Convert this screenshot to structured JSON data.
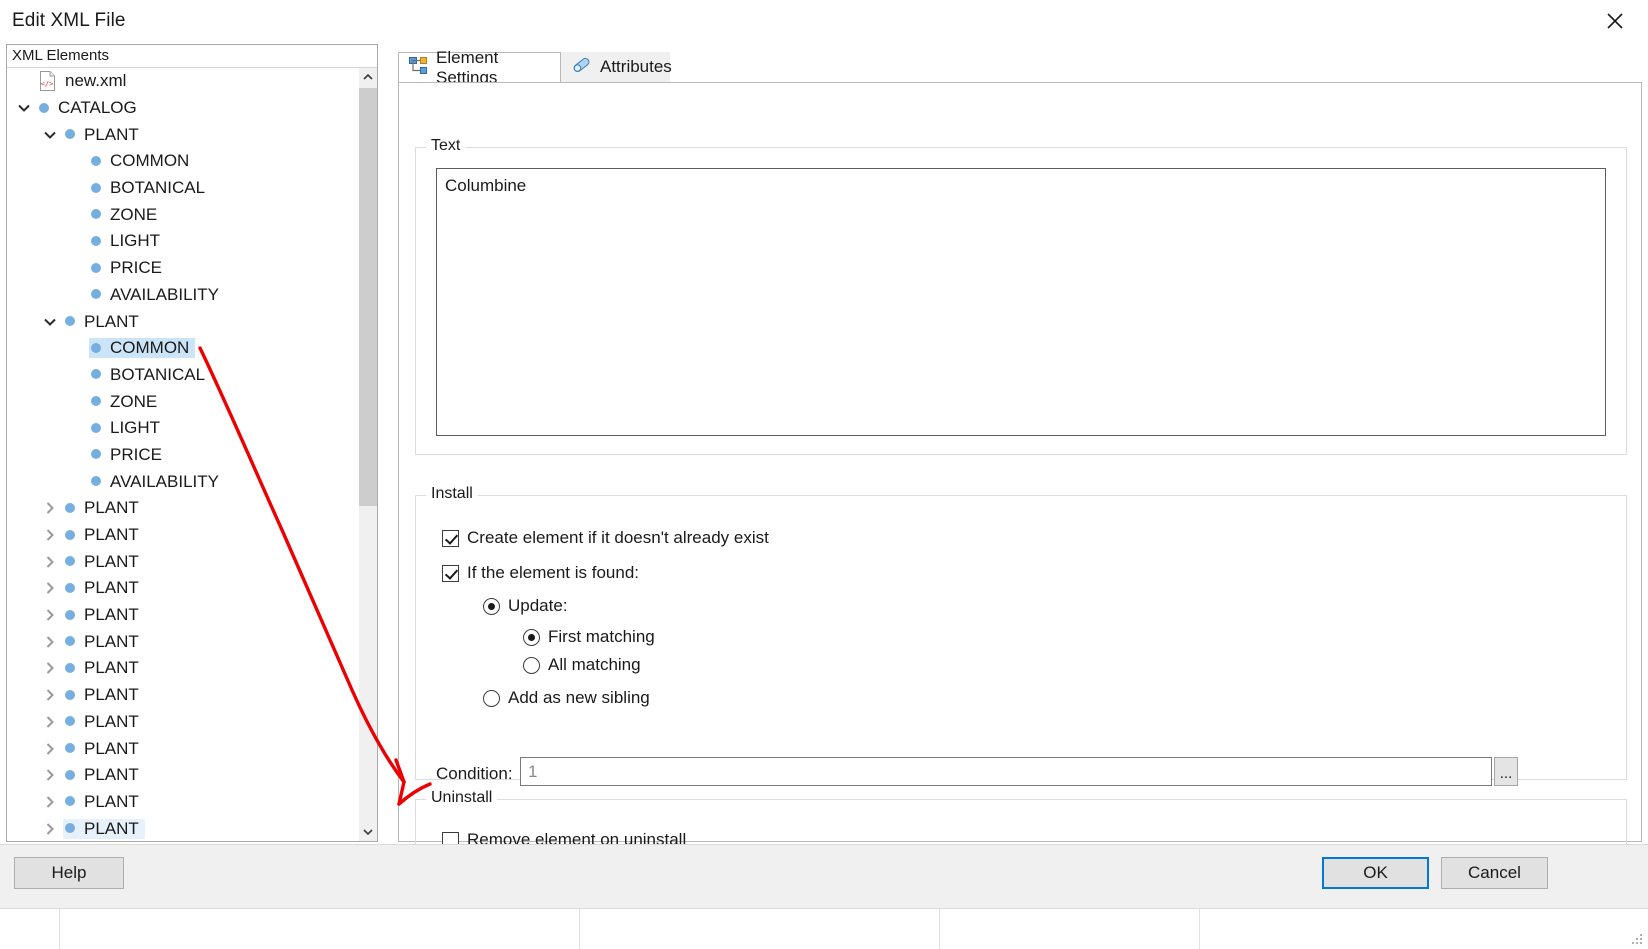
{
  "window": {
    "title": "Edit XML File",
    "close_label": "close-icon"
  },
  "tree": {
    "header": "XML Elements",
    "root": "new.xml",
    "nodes": [
      {
        "label": "new.xml",
        "indent": 0,
        "twisty": "none",
        "icon": "xml-file-icon",
        "state": "normal"
      },
      {
        "label": "CATALOG",
        "indent": 0,
        "twisty": "expanded",
        "icon": "bullet",
        "state": "normal"
      },
      {
        "label": "PLANT",
        "indent": 1,
        "twisty": "expanded",
        "icon": "bullet",
        "state": "normal"
      },
      {
        "label": "COMMON",
        "indent": 2,
        "twisty": "none",
        "icon": "bullet",
        "state": "normal"
      },
      {
        "label": "BOTANICAL",
        "indent": 2,
        "twisty": "none",
        "icon": "bullet",
        "state": "normal"
      },
      {
        "label": "ZONE",
        "indent": 2,
        "twisty": "none",
        "icon": "bullet",
        "state": "normal"
      },
      {
        "label": "LIGHT",
        "indent": 2,
        "twisty": "none",
        "icon": "bullet",
        "state": "normal"
      },
      {
        "label": "PRICE",
        "indent": 2,
        "twisty": "none",
        "icon": "bullet",
        "state": "normal"
      },
      {
        "label": "AVAILABILITY",
        "indent": 2,
        "twisty": "none",
        "icon": "bullet",
        "state": "normal"
      },
      {
        "label": "PLANT",
        "indent": 1,
        "twisty": "expanded",
        "icon": "bullet",
        "state": "normal"
      },
      {
        "label": "COMMON",
        "indent": 2,
        "twisty": "none",
        "icon": "bullet",
        "state": "selected"
      },
      {
        "label": "BOTANICAL",
        "indent": 2,
        "twisty": "none",
        "icon": "bullet",
        "state": "normal"
      },
      {
        "label": "ZONE",
        "indent": 2,
        "twisty": "none",
        "icon": "bullet",
        "state": "normal"
      },
      {
        "label": "LIGHT",
        "indent": 2,
        "twisty": "none",
        "icon": "bullet",
        "state": "normal"
      },
      {
        "label": "PRICE",
        "indent": 2,
        "twisty": "none",
        "icon": "bullet",
        "state": "normal"
      },
      {
        "label": "AVAILABILITY",
        "indent": 2,
        "twisty": "none",
        "icon": "bullet",
        "state": "normal"
      },
      {
        "label": "PLANT",
        "indent": 1,
        "twisty": "collapsed",
        "icon": "bullet",
        "state": "normal"
      },
      {
        "label": "PLANT",
        "indent": 1,
        "twisty": "collapsed",
        "icon": "bullet",
        "state": "normal"
      },
      {
        "label": "PLANT",
        "indent": 1,
        "twisty": "collapsed",
        "icon": "bullet",
        "state": "normal"
      },
      {
        "label": "PLANT",
        "indent": 1,
        "twisty": "collapsed",
        "icon": "bullet",
        "state": "normal"
      },
      {
        "label": "PLANT",
        "indent": 1,
        "twisty": "collapsed",
        "icon": "bullet",
        "state": "normal"
      },
      {
        "label": "PLANT",
        "indent": 1,
        "twisty": "collapsed",
        "icon": "bullet",
        "state": "normal"
      },
      {
        "label": "PLANT",
        "indent": 1,
        "twisty": "collapsed",
        "icon": "bullet",
        "state": "normal"
      },
      {
        "label": "PLANT",
        "indent": 1,
        "twisty": "collapsed",
        "icon": "bullet",
        "state": "normal"
      },
      {
        "label": "PLANT",
        "indent": 1,
        "twisty": "collapsed",
        "icon": "bullet",
        "state": "normal"
      },
      {
        "label": "PLANT",
        "indent": 1,
        "twisty": "collapsed",
        "icon": "bullet",
        "state": "normal"
      },
      {
        "label": "PLANT",
        "indent": 1,
        "twisty": "collapsed",
        "icon": "bullet",
        "state": "normal"
      },
      {
        "label": "PLANT",
        "indent": 1,
        "twisty": "collapsed",
        "icon": "bullet",
        "state": "normal"
      },
      {
        "label": "PLANT",
        "indent": 1,
        "twisty": "collapsed",
        "icon": "bullet",
        "state": "hover"
      }
    ],
    "scroll_up": "scroll-up-arrow",
    "scroll_down": "scroll-down-arrow"
  },
  "tabs": [
    {
      "id": "element-settings",
      "label": "Element Settings",
      "icon": "element-tree-icon",
      "active": true
    },
    {
      "id": "attributes",
      "label": "Attributes",
      "icon": "attribute-tag-icon",
      "active": false
    }
  ],
  "text_group": {
    "legend": "Text",
    "value": "Columbine",
    "placeholder": ""
  },
  "install_group": {
    "legend": "Install",
    "create_if_missing": {
      "label": "Create element if it doesn't already exist",
      "checked": true
    },
    "if_found": {
      "label": "If the element is found:",
      "checked": true
    },
    "update": {
      "label": "Update:",
      "selected": true
    },
    "first_matching": {
      "label": "First matching",
      "selected": true
    },
    "all_matching": {
      "label": "All matching",
      "selected": false
    },
    "add_sibling": {
      "label": "Add as new sibling",
      "selected": false
    },
    "condition": {
      "label": "Condition:",
      "value": "",
      "placeholder": "1",
      "browse_label": "..."
    }
  },
  "uninstall_group": {
    "legend": "Uninstall",
    "remove_on_uninstall": {
      "label": "Remove element on uninstall",
      "checked": false
    }
  },
  "footer": {
    "help": "Help",
    "ok": "OK",
    "cancel": "Cancel"
  },
  "colors": {
    "accent": "#0078d7",
    "selection": "#cce4f7",
    "node_bullet": "#77aee0",
    "annotation": "#ee0000"
  }
}
